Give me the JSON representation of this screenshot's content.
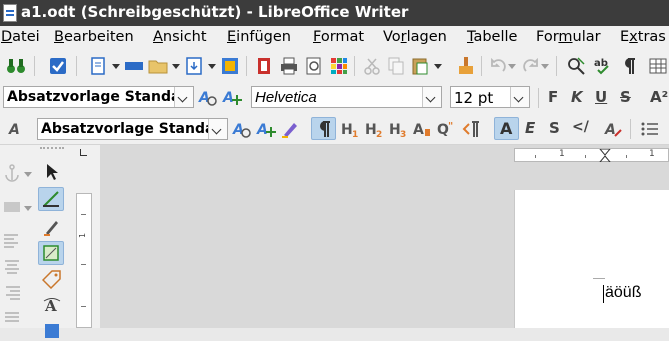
{
  "window": {
    "title": "a1.odt (Schreibgeschützt) - LibreOffice Writer"
  },
  "menu": [
    {
      "pre": "",
      "ul": "D",
      "post": "atei"
    },
    {
      "pre": "",
      "ul": "B",
      "post": "earbeiten"
    },
    {
      "pre": "",
      "ul": "A",
      "post": "nsicht"
    },
    {
      "pre": "",
      "ul": "E",
      "post": "infügen"
    },
    {
      "pre": "",
      "ul": "F",
      "post": "ormat"
    },
    {
      "pre": "Vo",
      "ul": "r",
      "post": "lagen"
    },
    {
      "pre": "",
      "ul": "T",
      "post": "abelle"
    },
    {
      "pre": "For",
      "ul": "m",
      "post": "ular"
    },
    {
      "pre": "E",
      "ul": "x",
      "post": "tras"
    }
  ],
  "formatting": {
    "paragraph_style": "Absatzvorlage Standa",
    "font_name": "Helvetica",
    "font_size": "12 pt",
    "bold": "F",
    "italic": "K",
    "underline": "U",
    "strike": "S",
    "superscript": "A²"
  },
  "sidebar_toolbar": {
    "paragraph_style": "Absatzvorlage Standa"
  },
  "ruler": {
    "tick_1": "1",
    "tick_2": "1",
    "vtick": "1"
  },
  "document": {
    "text": "äöüß"
  },
  "colors": {
    "titlebar": "#3c3c3c",
    "highlight": "#b9d4ec",
    "accent": "#2b6bc6"
  }
}
